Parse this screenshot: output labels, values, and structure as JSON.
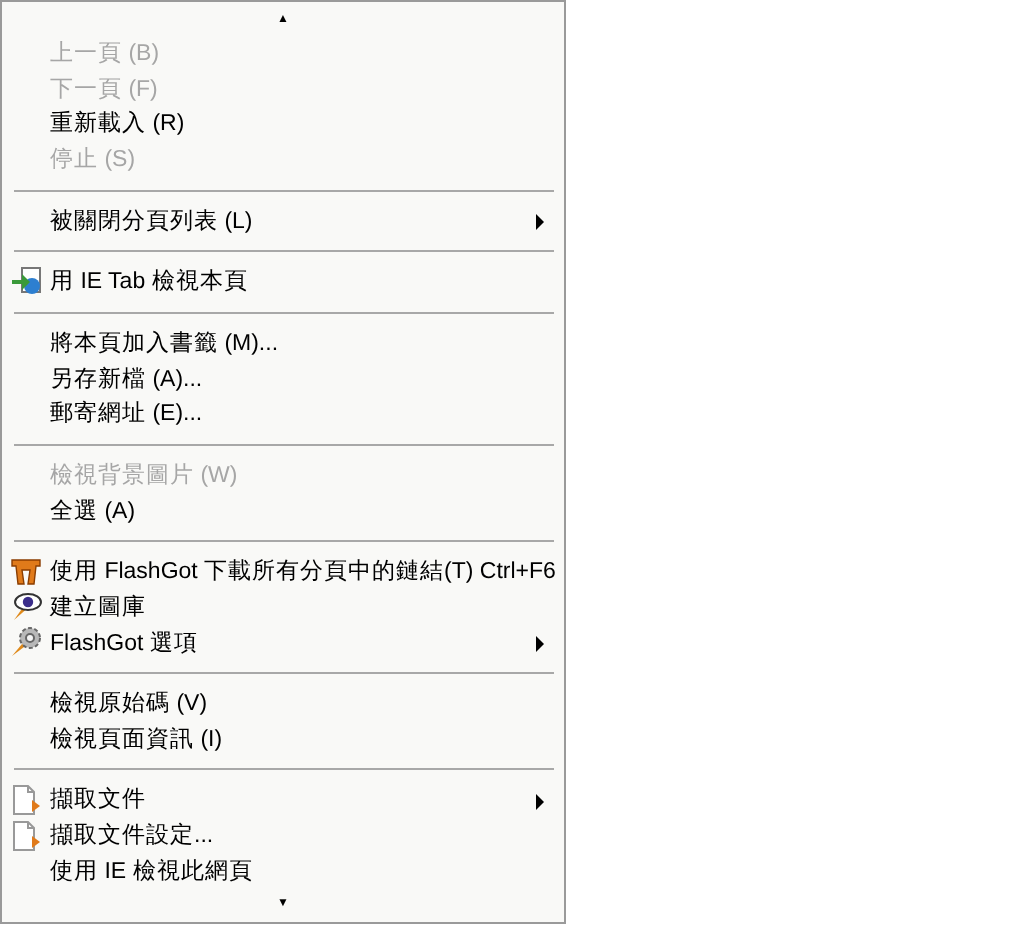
{
  "menu": {
    "scroll_up": "▲",
    "scroll_down": "▼",
    "groups": [
      [
        {
          "label": "上一頁 (B)",
          "disabled": true,
          "submenu": false,
          "kind": "plain"
        },
        {
          "label": "下一頁 (F)",
          "disabled": true,
          "submenu": false,
          "kind": "plain"
        },
        {
          "label": "重新載入 (R)",
          "disabled": false,
          "submenu": false,
          "kind": "plain"
        },
        {
          "label": "停止 (S)",
          "disabled": true,
          "submenu": false,
          "kind": "plain"
        }
      ],
      [
        {
          "label": "被關閉分頁列表 (L)",
          "disabled": false,
          "submenu": true,
          "kind": "plain"
        }
      ],
      [
        {
          "label": "用 IE Tab 檢視本頁",
          "disabled": false,
          "submenu": false,
          "kind": "icon"
        }
      ],
      [
        {
          "label": "將本頁加入書籤 (M)...",
          "disabled": false,
          "submenu": false,
          "kind": "plain"
        },
        {
          "label": "另存新檔 (A)...",
          "disabled": false,
          "submenu": false,
          "kind": "plain"
        },
        {
          "label": "郵寄網址 (E)...",
          "disabled": false,
          "submenu": false,
          "kind": "plain"
        }
      ],
      [
        {
          "label": "檢視背景圖片 (W)",
          "disabled": true,
          "submenu": false,
          "kind": "plain"
        },
        {
          "label": "全選 (A)",
          "disabled": false,
          "submenu": false,
          "kind": "plain"
        }
      ],
      [
        {
          "label": "使用 FlashGot 下載所有分頁中的鏈結(T) Ctrl+F6",
          "disabled": false,
          "submenu": false,
          "kind": "icon"
        },
        {
          "label": "建立圖庫",
          "disabled": false,
          "submenu": false,
          "kind": "icon"
        },
        {
          "label": "FlashGot 選項",
          "disabled": false,
          "submenu": true,
          "kind": "icon"
        }
      ],
      [
        {
          "label": "檢視原始碼 (V)",
          "disabled": false,
          "submenu": false,
          "kind": "plain"
        },
        {
          "label": "檢視頁面資訊 (I)",
          "disabled": false,
          "submenu": false,
          "kind": "plain"
        }
      ],
      [
        {
          "label": "擷取文件",
          "disabled": false,
          "submenu": true,
          "kind": "icon"
        },
        {
          "label": "擷取文件設定...",
          "disabled": false,
          "submenu": false,
          "kind": "icon"
        },
        {
          "label": "使用 IE 檢視此網頁",
          "disabled": false,
          "submenu": false,
          "kind": "plain"
        }
      ]
    ]
  }
}
